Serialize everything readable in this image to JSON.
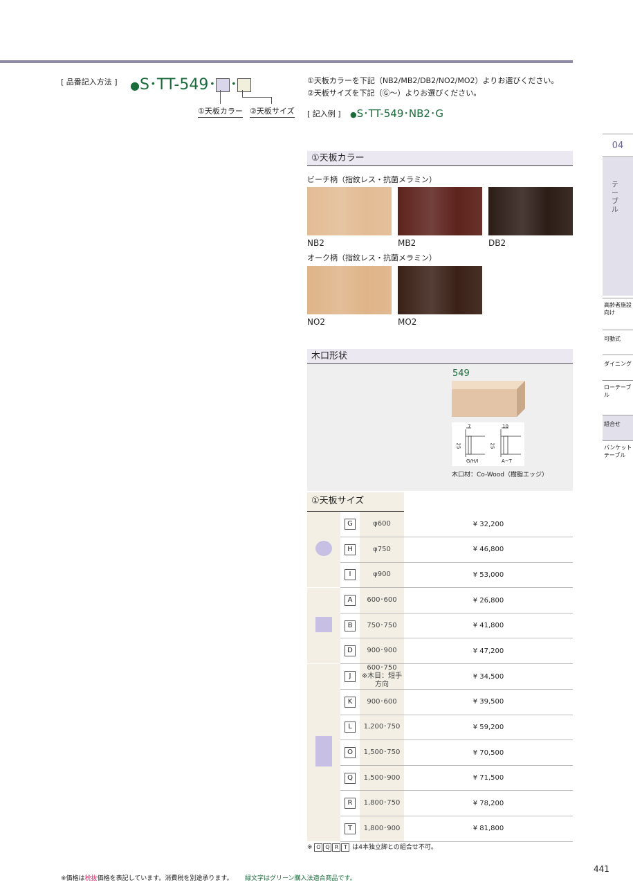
{
  "header": {
    "order_label": "[ 品番記入方法 ]",
    "model_prefix": "S･TT-549･",
    "model_sep": "･",
    "callout_color": "①天板カラー",
    "callout_size": "②天板サイズ",
    "instruction_1": "①天板カラーを下記（NB2/MB2/DB2/NO2/MO2）よりお選びください。",
    "instruction_2": "②天板サイズを下記（Ⓖ～）よりお選びください。",
    "example_label": "[ 記入例 ]",
    "example_value": "S･TT-549･NB2･G"
  },
  "color_section": {
    "title": "①天板カラー",
    "beech_label": "ビーチ柄（指紋レス・抗菌メラミン）",
    "oak_label": "オーク柄（指紋レス・抗菌メラミン）",
    "beech": [
      {
        "code": "NB2",
        "color": "#e2bc94"
      },
      {
        "code": "MB2",
        "color": "#5e231d"
      },
      {
        "code": "DB2",
        "color": "#2d1d17"
      }
    ],
    "oak": [
      {
        "code": "NO2",
        "color": "#dfb488"
      },
      {
        "code": "MO2",
        "color": "#3a2117"
      }
    ]
  },
  "edge_section": {
    "title": "木口形状",
    "model": "549",
    "dim_a": "7",
    "dim_b": "10",
    "dim_h": "25",
    "label_a": "G/H/I",
    "label_b": "A~T",
    "material": "木口材：Co-Wood（樹脂エッジ）"
  },
  "size_section": {
    "title": "①天板サイズ",
    "rows": [
      {
        "code": "G",
        "dim": "φ600",
        "note": "",
        "price": "¥ 32,200"
      },
      {
        "code": "H",
        "dim": "φ750",
        "note": "",
        "price": "¥ 46,800"
      },
      {
        "code": "I",
        "dim": "φ900",
        "note": "",
        "price": "¥ 53,000"
      },
      {
        "code": "A",
        "dim": "600･600",
        "note": "",
        "price": "¥ 26,800"
      },
      {
        "code": "B",
        "dim": "750･750",
        "note": "",
        "price": "¥ 41,800"
      },
      {
        "code": "D",
        "dim": "900･900",
        "note": "",
        "price": "¥ 47,200"
      },
      {
        "code": "J",
        "dim": "600･750",
        "note": "※木目：短手方向",
        "price": "¥ 34,500"
      },
      {
        "code": "K",
        "dim": "900･600",
        "note": "",
        "price": "¥ 39,500"
      },
      {
        "code": "L",
        "dim": "1,200･750",
        "note": "",
        "price": "¥ 59,200"
      },
      {
        "code": "O",
        "dim": "1,500･750",
        "note": "",
        "price": "¥ 70,500"
      },
      {
        "code": "Q",
        "dim": "1,500･900",
        "note": "",
        "price": "¥ 71,500"
      },
      {
        "code": "R",
        "dim": "1,800･750",
        "note": "",
        "price": "¥ 78,200"
      },
      {
        "code": "T",
        "dim": "1,800･900",
        "note": "",
        "price": "¥ 81,800"
      }
    ],
    "footnote_prefix": "※",
    "footnote_codes": [
      "O",
      "Q",
      "R",
      "T"
    ],
    "footnote_text": "は4本独立脚との組合せ不可。"
  },
  "sidebar": {
    "chapter": "04",
    "chapter_label": "テーブル",
    "items": [
      "高齢者施設向け",
      "可動式",
      "ダイニング",
      "ローテーブル",
      "組合せ",
      "バンケットテーブル"
    ]
  },
  "footer": {
    "note_a": "※価格は",
    "note_highlight": "税抜",
    "note_b": "価格を表記しています。消費税を別途承ります。",
    "green_note": "緑文字はグリーン購入法適合商品です。",
    "page": "441"
  }
}
